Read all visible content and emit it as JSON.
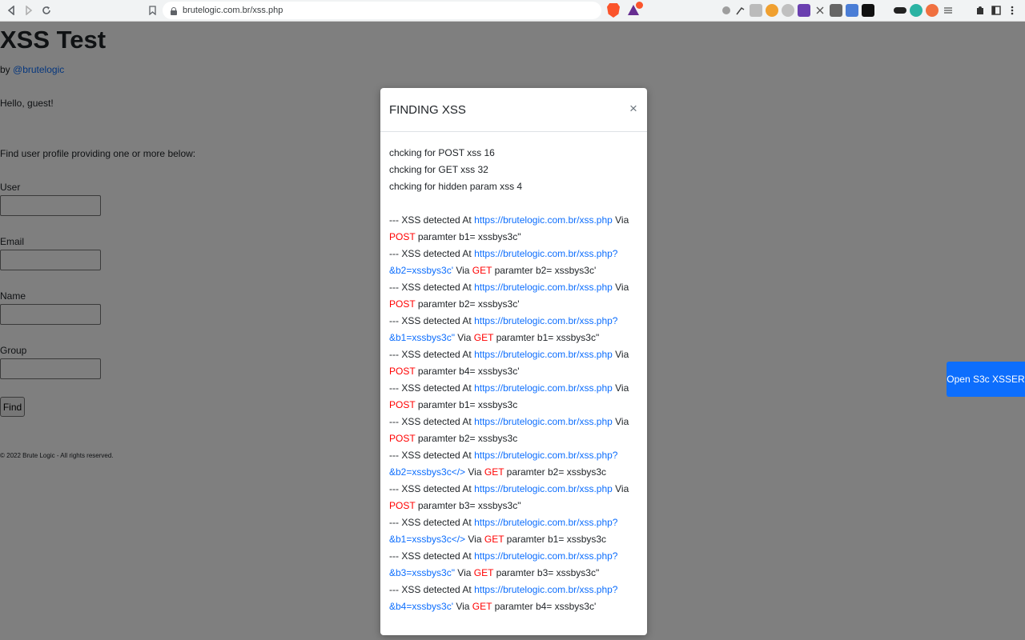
{
  "browser": {
    "url": "brutelogic.com.br/xss.php"
  },
  "page": {
    "title": "XSS Test",
    "by_prefix": "by ",
    "author_link": "@brutelogic",
    "greeting": "Hello, guest!",
    "find_instructions": "Find user profile providing one or more below:",
    "fields": [
      {
        "label": "User",
        "value": ""
      },
      {
        "label": "Email",
        "value": ""
      },
      {
        "label": "Name",
        "value": ""
      },
      {
        "label": "Group",
        "value": ""
      }
    ],
    "find_button": "Find",
    "footer": "© 2022 Brute Logic - All rights reserved."
  },
  "floating_button": {
    "label": "Open S3c XSSER"
  },
  "modal": {
    "title": "FINDING XSS",
    "close": "×",
    "checks": [
      "chcking for POST xss 16",
      "chcking for GET xss 32",
      "chcking for hidden param xss 4"
    ],
    "results": [
      {
        "prefix": "--- XSS detected At ",
        "url": "https://brutelogic.com.br/xss.php",
        "via": " Via ",
        "method": "POST",
        "param": "paramter b1= xssbys3c\""
      },
      {
        "prefix": "--- XSS detected At ",
        "url": "https://brutelogic.com.br/xss.php?&b2=xssbys3c'",
        "via": " Via ",
        "method": "GET",
        "param": "paramter b2= xssbys3c'"
      },
      {
        "prefix": "--- XSS detected At ",
        "url": "https://brutelogic.com.br/xss.php",
        "via": " Via ",
        "method": "POST",
        "param": "paramter b2= xssbys3c'"
      },
      {
        "prefix": "--- XSS detected At ",
        "url": "https://brutelogic.com.br/xss.php?&b1=xssbys3c\"",
        "via": " Via ",
        "method": "GET",
        "param": "paramter b1= xssbys3c\""
      },
      {
        "prefix": "--- XSS detected At ",
        "url": "https://brutelogic.com.br/xss.php",
        "via": " Via ",
        "method": "POST",
        "param": "paramter b4= xssbys3c'"
      },
      {
        "prefix": "--- XSS detected At ",
        "url": "https://brutelogic.com.br/xss.php",
        "via": " Via ",
        "method": "POST",
        "param": "paramter b1= xssbys3c"
      },
      {
        "prefix": "--- XSS detected At ",
        "url": "https://brutelogic.com.br/xss.php",
        "via": " Via ",
        "method": "POST",
        "param": "paramter b2= xssbys3c"
      },
      {
        "prefix": "--- XSS detected At ",
        "url": "https://brutelogic.com.br/xss.php?&b2=xssbys3c</>",
        "via": " Via ",
        "method": "GET",
        "param": "paramter b2= xssbys3c"
      },
      {
        "prefix": "--- XSS detected At ",
        "url": "https://brutelogic.com.br/xss.php",
        "via": " Via ",
        "method": "POST",
        "param": "paramter b3= xssbys3c\""
      },
      {
        "prefix": "--- XSS detected At ",
        "url": "https://brutelogic.com.br/xss.php?&b1=xssbys3c</>",
        "via": " Via ",
        "method": "GET",
        "param": "paramter b1= xssbys3c"
      },
      {
        "prefix": "--- XSS detected At ",
        "url": "https://brutelogic.com.br/xss.php?&b3=xssbys3c\"",
        "via": " Via ",
        "method": "GET",
        "param": "paramter b3= xssbys3c\""
      },
      {
        "prefix": "--- XSS detected At ",
        "url": "https://brutelogic.com.br/xss.php?&b4=xssbys3c'",
        "via": " Via ",
        "method": "GET",
        "param": "paramter b4= xssbys3c'"
      }
    ]
  },
  "colors": {
    "link": "#0d6efd",
    "method": "#ff0000",
    "backdrop": "rgba(0,0,0,0.5)"
  },
  "icons": {
    "back": "back-arrow-icon",
    "forward": "forward-arrow-icon",
    "reload": "reload-icon",
    "bookmark": "bookmark-icon",
    "lock": "lock-icon",
    "close": "close-icon"
  }
}
